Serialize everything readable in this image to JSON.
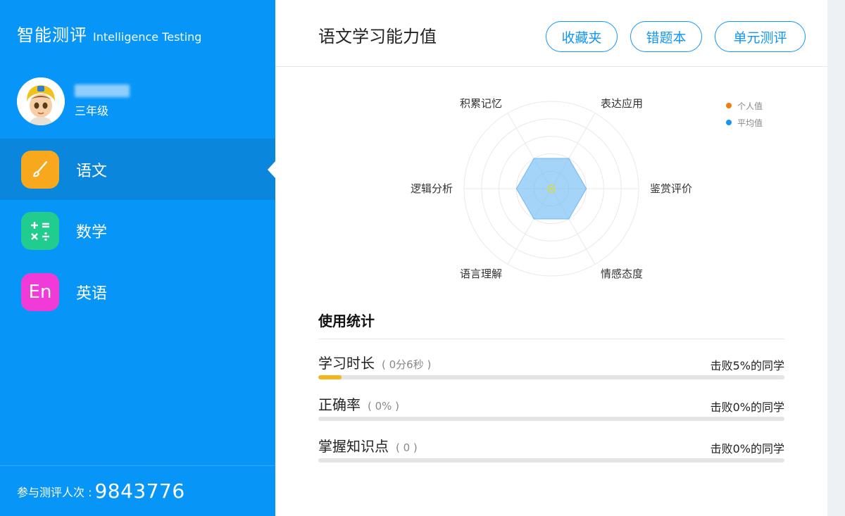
{
  "brand": {
    "title_cn": "智能测评",
    "title_en": "Intelligence Testing"
  },
  "user": {
    "grade": "三年级"
  },
  "nav": {
    "items": [
      {
        "label": "语文",
        "icon": "brush-icon",
        "color": "#f7a81c"
      },
      {
        "label": "数学",
        "icon": "calculator-icon",
        "color": "#20cd8e"
      },
      {
        "label": "英语",
        "icon": "english-icon",
        "color": "#f13bd9",
        "glyph": "En"
      }
    ],
    "active": 0
  },
  "footer": {
    "label": "参与测评人次 :",
    "count": "9843776"
  },
  "header": {
    "title": "语文学习能力值",
    "buttons": {
      "favorites": "收藏夹",
      "mistakes": "错题本",
      "unit_test": "单元测评"
    }
  },
  "radar": {
    "axes": [
      "表达应用",
      "鉴赏评价",
      "情感态度",
      "语言理解",
      "逻辑分析",
      "积累记忆"
    ],
    "max": 5,
    "average": [
      2,
      2,
      2,
      2,
      2,
      2
    ],
    "personal": [
      0,
      0,
      0,
      0,
      0,
      0
    ]
  },
  "legend": {
    "personal": "个人值",
    "average": "平均值",
    "personal_color": "#f57d0d",
    "average_color": "#1296f6"
  },
  "usage": {
    "title": "使用统计",
    "rows": [
      {
        "label": "学习时长",
        "value": "( 0分6秒 )",
        "rank": "击败5%的同学",
        "progress": 0.05
      },
      {
        "label": "正确率",
        "value": "( 0% )",
        "rank": "击败0%的同学",
        "progress": 0
      },
      {
        "label": "掌握知识点",
        "value": "( 0 )",
        "rank": "击败0%的同学",
        "progress": 0
      }
    ]
  }
}
